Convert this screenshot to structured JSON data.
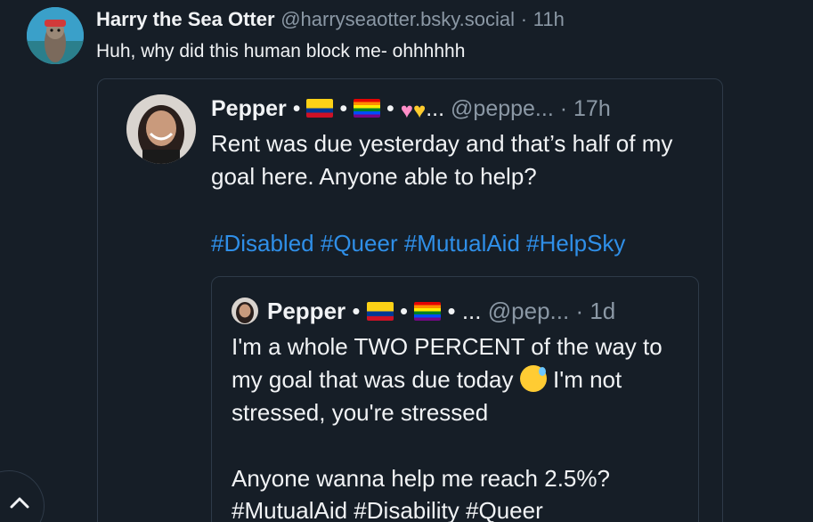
{
  "post": {
    "author_name": "Harry the Sea Otter",
    "handle": "@harryseaotter.bsky.social",
    "separator": "·",
    "time": "11h",
    "text": "Huh, why did this human block me- ohhhhhh",
    "avatar": "sea-otter-avatar"
  },
  "quote_1": {
    "author_name": "Pepper",
    "name_decorations": "• 🇨🇴 • 🏳️‍🌈 • 🩷💛...",
    "handle": "@peppe...",
    "separator": "·",
    "time": "17h",
    "text": "Rent was due yesterday and that’s half of my goal here. Anyone able to help?",
    "hashtags": [
      "#Disabled",
      "#Queer",
      "#MutualAid",
      "#HelpSky"
    ]
  },
  "quote_2": {
    "author_name": "Pepper",
    "name_decorations": "• 🇨🇴 • 🏳️‍🌈 • ...",
    "handle": "@pep...",
    "separator": "·",
    "time": "1d",
    "text_part1": "I'm a whole TWO PERCENT of the way to my goal that was due today",
    "text_part2": "I'm not stressed, you're stressed",
    "text_part3": "Anyone wanna help me reach 2.5%?",
    "hashtags": "#MutualAid #Disability #Queer"
  },
  "icons": {
    "scroll_top": "chevron-up-icon",
    "emoji": "grinning-sweat-emoji"
  },
  "colors": {
    "background": "#161e27",
    "link": "#2f8fe8",
    "muted": "#8b98a5",
    "border": "#2e3a48"
  }
}
